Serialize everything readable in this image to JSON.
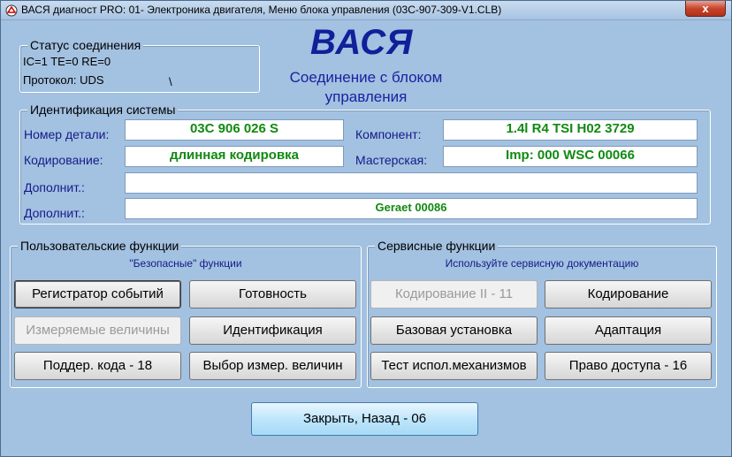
{
  "titlebar": {
    "title": "ВАСЯ диагност PRO: 01- Электроника двигателя,  Меню блока управления (03C-907-309-V1.CLB)",
    "close_label": "x"
  },
  "status": {
    "group_label": "Статус соединения",
    "line1": "IC=1  TE=0   RE=0",
    "protocol": "Протокол: UDS",
    "spinner": "\\"
  },
  "brand": {
    "title": "ВАСЯ",
    "conn_line1": "Соединение с блоком",
    "conn_line2": "управления"
  },
  "ident": {
    "group_label": "Идентификация системы",
    "part_label": "Номер детали:",
    "part_value": "03C 906 026 S",
    "component_label": "Компонент:",
    "component_value": "1.4l R4 TSI    H02 3729",
    "coding_label": "Кодирование:",
    "coding_value": "длинная кодировка",
    "workshop_label": "Мастерская:",
    "workshop_value": "Imp: 000      WSC 00066",
    "extra1_label": "Дополнит.:",
    "extra1_value": "",
    "extra2_label": "Дополнит.:",
    "extra2_value": "Geraet 00086"
  },
  "user_funcs": {
    "group_label": "Пользовательские функции",
    "caption": "\"Безопасные\" функции",
    "buttons": [
      "Регистратор событий",
      "Готовность",
      "Измеряемые величины",
      "Идентификация",
      "Поддер. кода - 18",
      "Выбор измер. величин"
    ]
  },
  "service_funcs": {
    "group_label": "Сервисные функции",
    "caption": "Используйте сервисную документацию",
    "buttons": [
      "Кодирование II - 11",
      "Кодирование",
      "Базовая установка",
      "Адаптация",
      "Тест испол.механизмов",
      "Право доступа - 16"
    ]
  },
  "footer": {
    "close_back": "Закрыть, Назад - 06"
  },
  "colors": {
    "background": "#a3c1e0",
    "label_blue": "#141a8a",
    "value_green": "#118a11",
    "brand_blue": "#10209a"
  }
}
